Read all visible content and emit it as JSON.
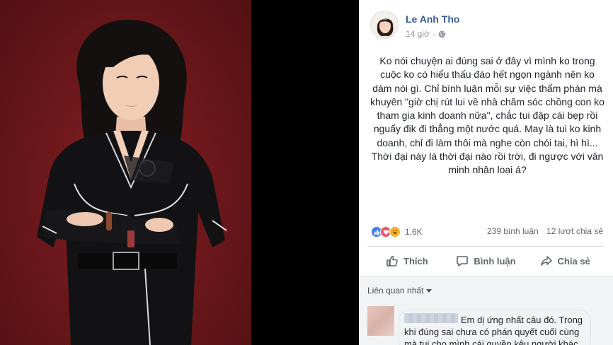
{
  "post": {
    "author": "Le Anh Tho",
    "time": "14 giờ",
    "privacy_icon": "globe-icon",
    "text": "Ko nói chuyện ai đúng sai ở đây vì mình ko trong cuộc ko có hiểu thấu đáo hết ngọn ngành nên ko dám nói gì. Chỉ bình luận mỗi sự việc thẩm phán mà khuyên \"giờ chị rút lui về nhà chăm sóc chồng con ko tham gia kinh doanh nữa\", chắc tui đập cái bẹp rồi nguẩy đik đi thẳng một nước quá. May là tui ko kinh doanh, chỉ đi làm thôi mà nghe còn chói tai, hì hì... Thời đại này là thời đại nào rồi trời, đi ngược với văn minh nhân loại á?"
  },
  "stats": {
    "reaction_count": "1,6K",
    "comments": "239 bình luận",
    "shares": "12 lượt chia sẻ"
  },
  "actions": {
    "like": "Thích",
    "comment": "Bình luận",
    "share": "Chia sẻ"
  },
  "comments_section": {
    "sort_label": "Liên quan nhất",
    "first_comment": "Em dị ứng nhất câu đó. Trong khi đúng sai chưa có phán quyết cuối cùng mà tui cho mình cái quyền kêu người khác"
  },
  "colors": {
    "photo_background": "#6e181c",
    "link_blue": "#365899",
    "like_blue": "#4080ff",
    "love_red": "#f25268",
    "haha_yellow": "#f7b125"
  }
}
